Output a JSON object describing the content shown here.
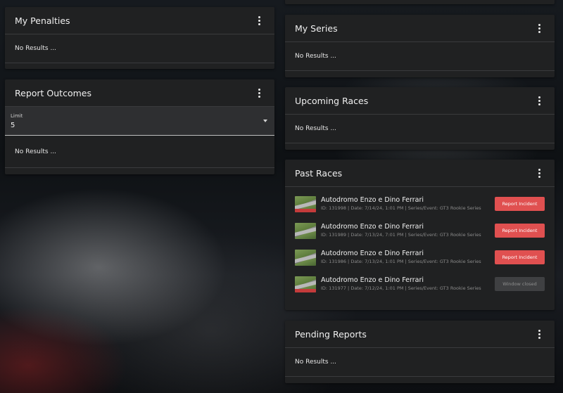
{
  "left": {
    "penalties": {
      "title": "My Penalties",
      "empty_text": "No Results ..."
    },
    "report_outcomes": {
      "title": "Report Outcomes",
      "limit_label": "Limit",
      "limit_value": "5",
      "empty_text": "No Results ..."
    }
  },
  "right": {
    "series": {
      "title": "My Series",
      "empty_text": "No Results ..."
    },
    "upcoming": {
      "title": "Upcoming Races",
      "empty_text": "No Results ..."
    },
    "past": {
      "title": "Past Races",
      "races": [
        {
          "name": "Autodromo Enzo e Dino Ferrari",
          "meta": "ID: 131998 | Date: 7/14/24, 1:01 PM | Series/Event: GT3 Rookie Series",
          "action": "Report Incident",
          "action_state": "enabled"
        },
        {
          "name": "Autodromo Enzo e Dino Ferrari",
          "meta": "ID: 131989 | Date: 7/13/24, 7:01 PM | Series/Event: GT3 Rookie Series",
          "action": "Report Incident",
          "action_state": "enabled"
        },
        {
          "name": "Autodromo Enzo e Dino Ferrari",
          "meta": "ID: 131986 | Date: 7/13/24, 1:01 PM | Series/Event: GT3 Rookie Series",
          "action": "Report Incident",
          "action_state": "enabled"
        },
        {
          "name": "Autodromo Enzo e Dino Ferrari",
          "meta": "ID: 131977 | Date: 7/12/24, 1:01 PM | Series/Event: GT3 Rookie Series",
          "action": "Window closed",
          "action_state": "disabled"
        }
      ]
    },
    "pending": {
      "title": "Pending Reports",
      "empty_text": "No Results ..."
    }
  },
  "icons": {
    "menu": "more-vertical-icon",
    "dropdown": "caret-down-icon"
  },
  "colors": {
    "accent_red": "#e05050",
    "card_bg": "#202122"
  }
}
